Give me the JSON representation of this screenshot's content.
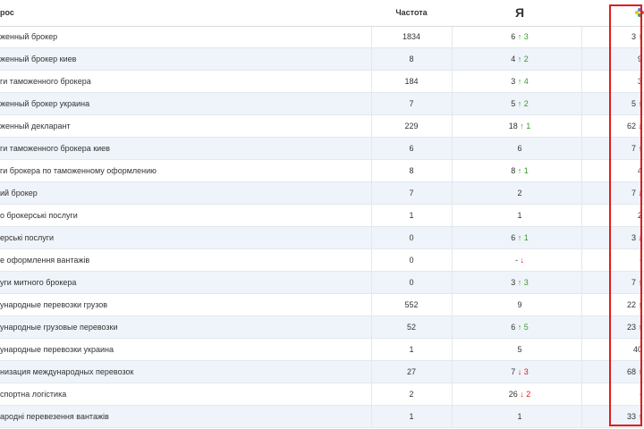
{
  "header": {
    "query": "рос",
    "frequency": "Частота",
    "yandex_logo": "Я",
    "google_icon": "google-icon"
  },
  "colors": {
    "up": "#3a9a2a",
    "down": "#d82020",
    "highlight_box": "#e11b1b",
    "yandex": "#e02020"
  },
  "rows": [
    {
      "query": "женный брокер",
      "freq": "1834",
      "y_pos": "6",
      "y_dir": "up",
      "y_delta": "3",
      "g_pos": "3",
      "g_dir": "up"
    },
    {
      "query": "женный брокер киев",
      "freq": "8",
      "y_pos": "4",
      "y_dir": "up",
      "y_delta": "2",
      "g_pos": "9",
      "g_dir": ""
    },
    {
      "query": "ги таможенного брокера",
      "freq": "184",
      "y_pos": "3",
      "y_dir": "up",
      "y_delta": "4",
      "g_pos": "3",
      "g_dir": ""
    },
    {
      "query": "женный брокер украина",
      "freq": "7",
      "y_pos": "5",
      "y_dir": "up",
      "y_delta": "2",
      "g_pos": "5",
      "g_dir": "up"
    },
    {
      "query": "женный декларант",
      "freq": "229",
      "y_pos": "18",
      "y_dir": "up",
      "y_delta": "1",
      "g_pos": "62",
      "g_dir": "down"
    },
    {
      "query": "ги таможенного брокера киев",
      "freq": "6",
      "y_pos": "6",
      "y_dir": "",
      "y_delta": "",
      "g_pos": "7",
      "g_dir": "up"
    },
    {
      "query": "ги брокера по таможенному оформлению",
      "freq": "8",
      "y_pos": "8",
      "y_dir": "up",
      "y_delta": "1",
      "g_pos": "4",
      "g_dir": ""
    },
    {
      "query": "ий брокер",
      "freq": "7",
      "y_pos": "2",
      "y_dir": "",
      "y_delta": "",
      "g_pos": "7",
      "g_dir": "down"
    },
    {
      "query": "о брокерські послуги",
      "freq": "1",
      "y_pos": "1",
      "y_dir": "",
      "y_delta": "",
      "g_pos": "2",
      "g_dir": ""
    },
    {
      "query": "ерські послуги",
      "freq": "0",
      "y_pos": "6",
      "y_dir": "up",
      "y_delta": "1",
      "g_pos": "3",
      "g_dir": "down"
    },
    {
      "query": "е оформлення вантажів",
      "freq": "0",
      "y_pos": "-",
      "y_dir": "down",
      "y_delta": "",
      "g_pos": "-",
      "g_dir": ""
    },
    {
      "query": "уги митного брокера",
      "freq": "0",
      "y_pos": "3",
      "y_dir": "up",
      "y_delta": "3",
      "g_pos": "7",
      "g_dir": "up"
    },
    {
      "query": "ународные перевозки грузов",
      "freq": "552",
      "y_pos": "9",
      "y_dir": "",
      "y_delta": "",
      "g_pos": "22",
      "g_dir": "up"
    },
    {
      "query": "ународные грузовые перевозки",
      "freq": "52",
      "y_pos": "6",
      "y_dir": "up",
      "y_delta": "5",
      "g_pos": "23",
      "g_dir": "up"
    },
    {
      "query": "ународные перевозки украина",
      "freq": "1",
      "y_pos": "5",
      "y_dir": "",
      "y_delta": "",
      "g_pos": "40",
      "g_dir": ""
    },
    {
      "query": "низация международных перевозок",
      "freq": "27",
      "y_pos": "7",
      "y_dir": "down",
      "y_delta": "3",
      "g_pos": "68",
      "g_dir": "up"
    },
    {
      "query": "спортна логістика",
      "freq": "2",
      "y_pos": "26",
      "y_dir": "down",
      "y_delta": "2",
      "g_pos": "-",
      "g_dir": ""
    },
    {
      "query": "ародні перевезення вантажів",
      "freq": "1",
      "y_pos": "1",
      "y_dir": "",
      "y_delta": "",
      "g_pos": "33",
      "g_dir": "up"
    }
  ]
}
